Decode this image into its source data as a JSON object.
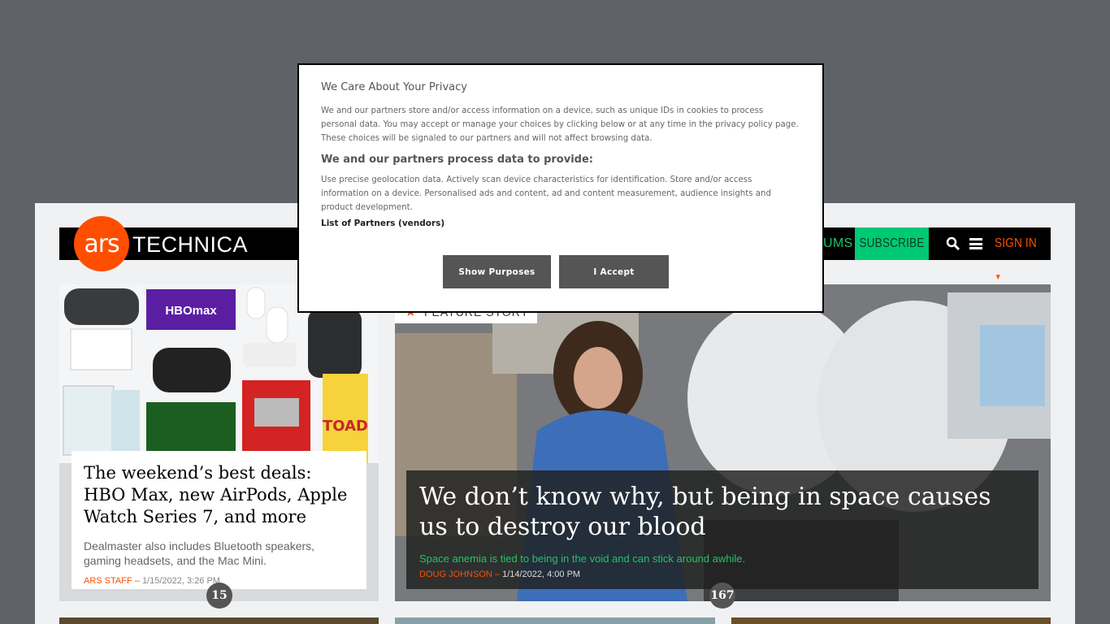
{
  "header": {
    "logo_short": "ars",
    "logo_long": "TECHNICA",
    "nav_forums": "UMS",
    "subscribe": "SUBSCRIBE",
    "signin": "SIGN IN",
    "brand_orange": "#ff4e00",
    "subscribe_green": "#00c974"
  },
  "deal_card": {
    "title": "The weekend’s best deals: HBO Max, new AirPods, Apple Watch Series 7, and more",
    "excerpt": "Dealmaster also includes Bluetooth speakers, gaming headsets, and the Mac Mini.",
    "author": "ARS STAFF",
    "separator": " – ",
    "date": "1/15/2022, 3:26 PM",
    "comments": "15"
  },
  "feature_card": {
    "label": "FEATURE STORY",
    "title": "We don’t know why, but being in space causes us to destroy our blood",
    "subtitle": "Space anemia is tied to being in the void and can stick around awhile.",
    "author": "DOUG JOHNSON",
    "separator": " – ",
    "date": "1/14/2022, 4:00 PM",
    "comments": "167"
  },
  "privacy_modal": {
    "heading": "We Care About Your Privacy",
    "intro": "We and our partners store and/or access information on a device, such as unique IDs in cookies to process personal data. You may accept or manage your choices by clicking below or at any time in the privacy policy page. These choices will be signaled to our partners and will not affect browsing data.",
    "purposes_heading": "We and our partners process data to provide:",
    "purposes_text": "Use precise geolocation data. Actively scan device characteristics for identification. Store and/or access information on a device. Personalised ads and content, ad and content measurement, audience insights and product development.",
    "partners_link": "List of Partners (vendors)",
    "show_purposes_button": "Show Purposes",
    "accept_button": "I Accept"
  }
}
